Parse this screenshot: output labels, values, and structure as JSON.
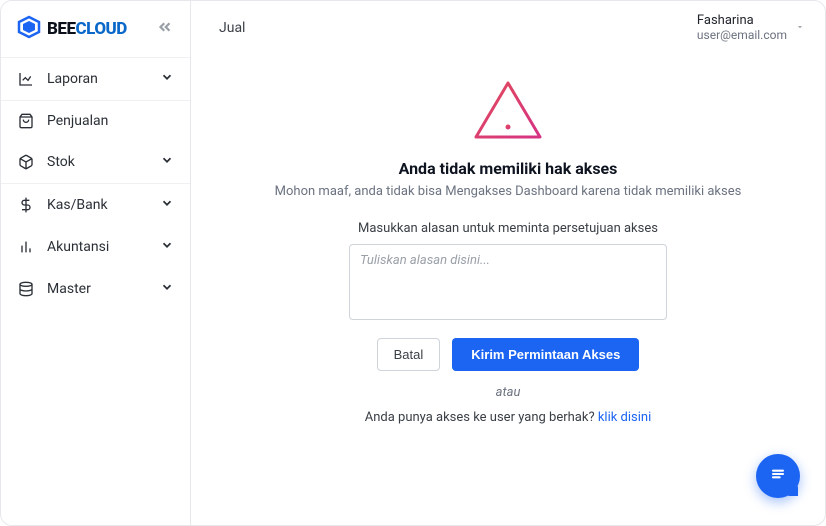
{
  "brand": {
    "name_a": "BEE",
    "name_b": "CLOUD"
  },
  "sidebar": {
    "items": [
      {
        "label": "Laporan",
        "expandable": true
      },
      {
        "label": "Penjualan",
        "expandable": false
      },
      {
        "label": "Stok",
        "expandable": true
      },
      {
        "label": "Kas/Bank",
        "expandable": true
      },
      {
        "label": "Akuntansi",
        "expandable": true
      },
      {
        "label": "Master",
        "expandable": true
      }
    ]
  },
  "topbar": {
    "title": "Jual",
    "user_name": "Fasharina",
    "user_email": "user@email.com"
  },
  "access": {
    "title": "Anda tidak memiliki hak akses",
    "subtitle": "Mohon maaf, anda tidak bisa Mengakses Dashboard karena tidak memiliki akses",
    "section_label": "Masukkan alasan untuk meminta persetujuan akses",
    "placeholder": "Tuliskan alasan disini...",
    "cancel_label": "Batal",
    "submit_label": "Kirim Permintaan Akses",
    "or_label": "atau",
    "alt_text": "Anda punya akses ke user yang berhak? ",
    "alt_link": "klik disini"
  }
}
